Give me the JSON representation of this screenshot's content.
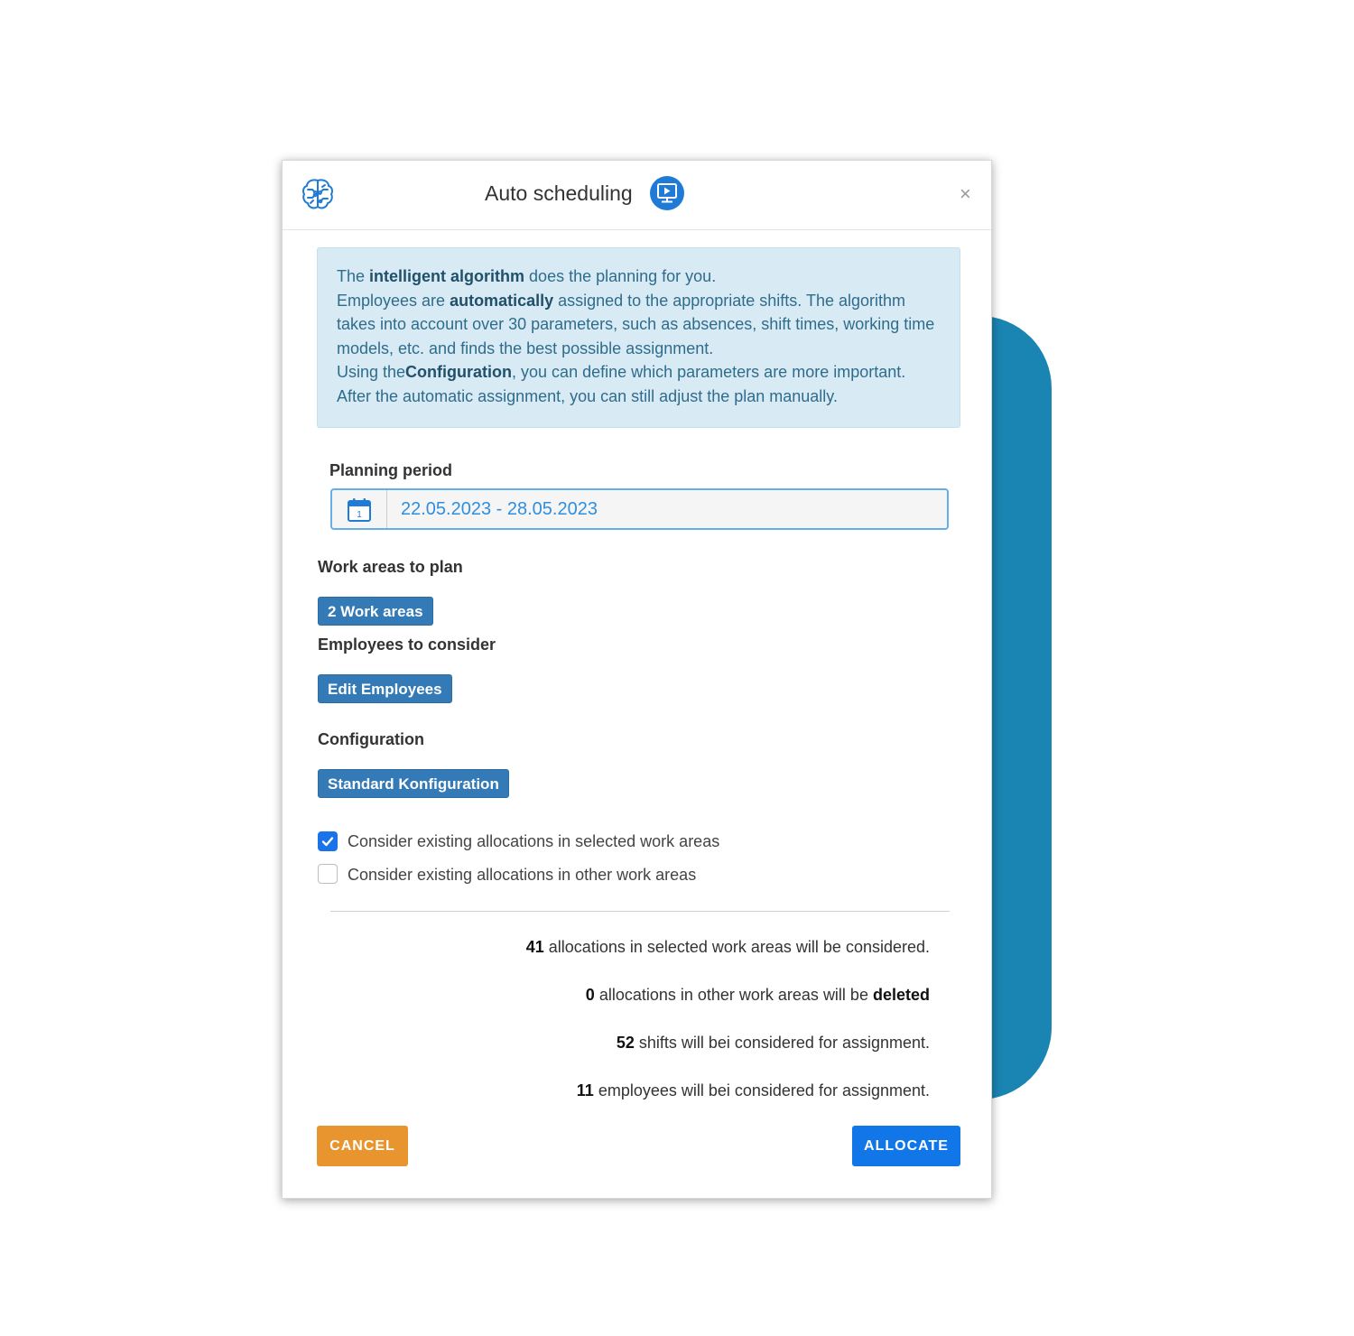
{
  "modal": {
    "title": "Auto scheduling",
    "close_glyph": "×"
  },
  "info": {
    "l1_a": "The ",
    "l1_b": "intelligent algorithm",
    "l1_c": " does the planning for you.",
    "l2_a": "Employees are ",
    "l2_b": "automatically",
    "l2_c": " assigned to the appropriate shifts. The algorithm takes into account over 30 parameters, such as absences, shift times, working time models, etc. and finds the best possible assignment.",
    "l3_a": "Using the",
    "l3_b": "Configuration",
    "l3_c": ", you can define which parameters are more important.",
    "l4": "After the automatic assignment, you can still adjust the plan manually."
  },
  "planning_period": {
    "label": "Planning period",
    "value": "22.05.2023 - 28.05.2023",
    "calendar_day": "1"
  },
  "work_areas": {
    "label": "Work areas to plan",
    "button": "2 Work areas"
  },
  "employees": {
    "label": "Employees to consider",
    "button": "Edit Employees"
  },
  "configuration": {
    "label": "Configuration",
    "button": "Standard Konfiguration"
  },
  "checkboxes": [
    {
      "label": "Consider existing allocations in selected work areas",
      "checked": true
    },
    {
      "label": "Consider existing allocations in other work areas",
      "checked": false
    }
  ],
  "summary": {
    "s1_num": "41",
    "s1_text": " allocations in selected work areas will be considered.",
    "s2_num": "0",
    "s2_text": " allocations in other work areas will be ",
    "s2_bold": "deleted",
    "s3_num": "52",
    "s3_text": " shifts will bei considered for assignment.",
    "s4_num": "11",
    "s4_text": " employees will bei considered for assignment."
  },
  "footer": {
    "cancel": "CANCEL",
    "allocate": "ALLOCATE"
  },
  "colors": {
    "accent_teal": "#1a85b2",
    "info_bg": "#d8ebf4",
    "button_blue": "#337ab7",
    "allocate_blue": "#1177e8",
    "cancel_orange": "#e8952f"
  },
  "icons": {
    "header_left": "brain-circuit-icon",
    "header_help": "video-tutorial-icon",
    "date": "calendar-icon",
    "check": "checkmark-icon"
  }
}
